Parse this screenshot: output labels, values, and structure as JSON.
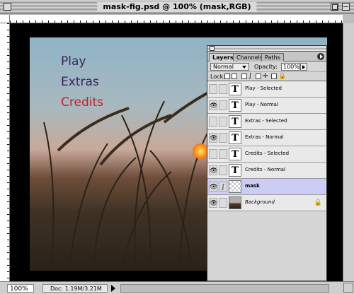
{
  "window": {
    "title": "mask-fig.psd @ 100% (mask,RGB)"
  },
  "canvas": {
    "menu_words": [
      "Play",
      "Extras",
      "Credits"
    ],
    "colors": {
      "play": "#3b1f5a",
      "extras": "#3b1f5a",
      "credits": "#c0202a"
    }
  },
  "status": {
    "zoom": "100%",
    "doc_info": "Doc: 1.19M/3.21M"
  },
  "layers_palette": {
    "tabs": [
      {
        "label": "Layers",
        "active": true
      },
      {
        "label": "Channels",
        "active": false
      },
      {
        "label": "Paths",
        "active": false
      }
    ],
    "blend_mode": "Normal",
    "opacity_label": "Opacity:",
    "opacity_value": "100%",
    "lock_label": "Lock:",
    "layers": [
      {
        "name": "Play - Selected",
        "visible": false,
        "thumb": "T",
        "selected": false
      },
      {
        "name": "Play - Normal",
        "visible": true,
        "thumb": "T",
        "selected": false
      },
      {
        "name": "Extras - Selected",
        "visible": false,
        "thumb": "T",
        "selected": false
      },
      {
        "name": "Extras - Normal",
        "visible": true,
        "thumb": "T",
        "selected": false
      },
      {
        "name": "Credits - Selected",
        "visible": false,
        "thumb": "T",
        "selected": false
      },
      {
        "name": "Credits - Normal",
        "visible": true,
        "thumb": "T",
        "selected": false
      },
      {
        "name": "mask",
        "visible": true,
        "thumb": "",
        "selected": true
      },
      {
        "name": "Background",
        "visible": true,
        "thumb": "",
        "selected": false
      }
    ]
  }
}
